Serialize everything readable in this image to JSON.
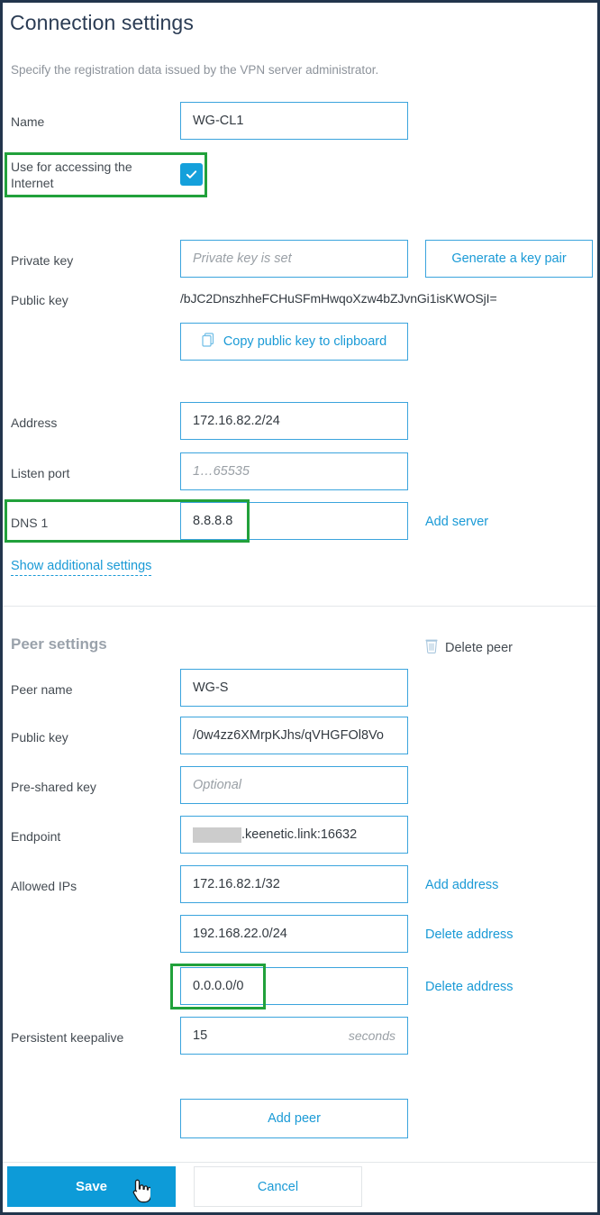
{
  "header": {
    "title": "Connection settings",
    "subtitle": "Specify the registration data issued by the VPN server administrator."
  },
  "connection": {
    "name_label": "Name",
    "name_value": "WG-CL1",
    "internet_checkbox_label": "Use for accessing the\nInternet",
    "internet_checked": true,
    "private_key_label": "Private key",
    "private_key_placeholder": "Private key is set",
    "generate_key_label": "Generate a key pair",
    "public_key_label": "Public key",
    "public_key_value": "/bJC2DnszhheFCHuSFmHwqoXzw4bZJvnGi1isKWOSjI=",
    "copy_public_key_label": "Copy public key to clipboard",
    "address_label": "Address",
    "address_value": "172.16.82.2/24",
    "listen_port_label": "Listen port",
    "listen_port_placeholder": "1…65535",
    "dns1_label": "DNS 1",
    "dns1_value": "8.8.8.8",
    "add_server_label": "Add server",
    "show_additional_label": "Show additional settings"
  },
  "peer": {
    "section_title": "Peer settings",
    "delete_peer_label": "Delete peer",
    "peer_name_label": "Peer name",
    "peer_name_value": "WG-S",
    "public_key_label": "Public key",
    "public_key_value": "/0w4zz6XMrpKJhs/qVHGFOl8Vo",
    "preshared_key_label": "Pre-shared key",
    "preshared_key_placeholder": "Optional",
    "endpoint_label": "Endpoint",
    "endpoint_value_suffix": ".keenetic.link:16632",
    "endpoint_redacted": true,
    "allowed_ips_label": "Allowed IPs",
    "allowed_ips": [
      {
        "value": "172.16.82.1/32",
        "action": "Add address"
      },
      {
        "value": "192.168.22.0/24",
        "action": "Delete address"
      },
      {
        "value": "0.0.0.0/0",
        "action": "Delete address"
      }
    ],
    "keepalive_label": "Persistent keepalive",
    "keepalive_value": "15",
    "keepalive_unit": "seconds",
    "add_peer_label": "Add peer"
  },
  "footer": {
    "save_label": "Save",
    "cancel_label": "Cancel"
  },
  "colors": {
    "accent": "#1a9ad6",
    "save_bg": "#0d9bd8",
    "field_border": "#3ba4dd",
    "highlight": "#21a13b",
    "title": "#2b3c54",
    "page_border": "#22354c",
    "redaction": "#cccccc"
  },
  "icons": {
    "copy": "copy-icon",
    "trash": "trash-icon",
    "check": "check-icon",
    "cursor": "hand-pointer-cursor"
  }
}
